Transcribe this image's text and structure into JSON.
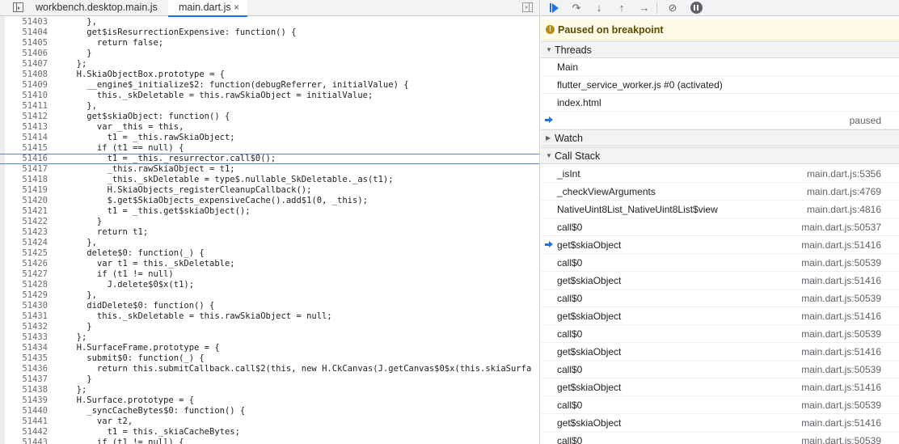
{
  "tabs": [
    {
      "label": "workbench.desktop.main.js"
    },
    {
      "label": "main.dart.js",
      "close": "×"
    }
  ],
  "code": {
    "current_line": 51416,
    "lines": [
      {
        "n": "51403",
        "t": "    },"
      },
      {
        "n": "51404",
        "t": "    get$isResurrectionExpensive: function() {"
      },
      {
        "n": "51405",
        "t": "      return false;"
      },
      {
        "n": "51406",
        "t": "    }"
      },
      {
        "n": "51407",
        "t": "  };"
      },
      {
        "n": "51408",
        "t": "  H.SkiaObjectBox.prototype = {"
      },
      {
        "n": "51409",
        "t": "    __engine$_initialize$2: function(debugReferrer, initialValue) {"
      },
      {
        "n": "51410",
        "t": "      this._skDeletable = this.rawSkiaObject = initialValue;"
      },
      {
        "n": "51411",
        "t": "    },"
      },
      {
        "n": "51412",
        "t": "    get$skiaObject: function() {"
      },
      {
        "n": "51413",
        "t": "      var _this = this,"
      },
      {
        "n": "51414",
        "t": "        t1 = _this.rawSkiaObject;"
      },
      {
        "n": "51415",
        "t": "      if (t1 == null) {"
      },
      {
        "n": "51416",
        "t": "        t1 = _this._resurrector.call$0();"
      },
      {
        "n": "51417",
        "t": "        _this.rawSkiaObject = t1;"
      },
      {
        "n": "51418",
        "t": "        _this._skDeletable = type$.nullable_SkDeletable._as(t1);"
      },
      {
        "n": "51419",
        "t": "        H.SkiaObjects_registerCleanupCallback();"
      },
      {
        "n": "51420",
        "t": "        $.get$SkiaObjects_expensiveCache().add$1(0, _this);"
      },
      {
        "n": "51421",
        "t": "        t1 = _this.get$skiaObject();"
      },
      {
        "n": "51422",
        "t": "      }"
      },
      {
        "n": "51423",
        "t": "      return t1;"
      },
      {
        "n": "51424",
        "t": "    },"
      },
      {
        "n": "51425",
        "t": "    delete$0: function(_) {"
      },
      {
        "n": "51426",
        "t": "      var t1 = this._skDeletable;"
      },
      {
        "n": "51427",
        "t": "      if (t1 != null)"
      },
      {
        "n": "51428",
        "t": "        J.delete$0$x(t1);"
      },
      {
        "n": "51429",
        "t": "    },"
      },
      {
        "n": "51430",
        "t": "    didDelete$0: function() {"
      },
      {
        "n": "51431",
        "t": "      this._skDeletable = this.rawSkiaObject = null;"
      },
      {
        "n": "51432",
        "t": "    }"
      },
      {
        "n": "51433",
        "t": "  };"
      },
      {
        "n": "51434",
        "t": "  H.SurfaceFrame.prototype = {"
      },
      {
        "n": "51435",
        "t": "    submit$0: function(_) {"
      },
      {
        "n": "51436",
        "t": "      return this.submitCallback.call$2(this, new H.CkCanvas(J.getCanvas$0$x(this.skiaSurfa"
      },
      {
        "n": "51437",
        "t": "    }"
      },
      {
        "n": "51438",
        "t": "  };"
      },
      {
        "n": "51439",
        "t": "  H.Surface.prototype = {"
      },
      {
        "n": "51440",
        "t": "    _syncCacheBytes$0: function() {"
      },
      {
        "n": "51441",
        "t": "      var t2,"
      },
      {
        "n": "51442",
        "t": "        t1 = this._skiaCacheBytes;"
      },
      {
        "n": "51443",
        "t": "      if (t1 != null) {"
      }
    ]
  },
  "debugger": {
    "paused_message": "Paused on breakpoint",
    "threads": {
      "label": "Threads",
      "items": [
        {
          "name": "Main",
          "status": ""
        },
        {
          "name": "flutter_service_worker.js #0 (activated)",
          "status": ""
        },
        {
          "name": "index.html",
          "status": ""
        },
        {
          "name": "",
          "status": "paused",
          "current": true
        }
      ]
    },
    "watch": {
      "label": "Watch"
    },
    "call_stack": {
      "label": "Call Stack",
      "frames": [
        {
          "fn": "_isInt",
          "loc": "main.dart.js:5356"
        },
        {
          "fn": "_checkViewArguments",
          "loc": "main.dart.js:4769"
        },
        {
          "fn": "NativeUint8List_NativeUint8List$view",
          "loc": "main.dart.js:4816"
        },
        {
          "fn": "call$0",
          "loc": "main.dart.js:50537"
        },
        {
          "fn": "get$skiaObject",
          "loc": "main.dart.js:51416",
          "current": true
        },
        {
          "fn": "call$0",
          "loc": "main.dart.js:50539"
        },
        {
          "fn": "get$skiaObject",
          "loc": "main.dart.js:51416"
        },
        {
          "fn": "call$0",
          "loc": "main.dart.js:50539"
        },
        {
          "fn": "get$skiaObject",
          "loc": "main.dart.js:51416"
        },
        {
          "fn": "call$0",
          "loc": "main.dart.js:50539"
        },
        {
          "fn": "get$skiaObject",
          "loc": "main.dart.js:51416"
        },
        {
          "fn": "call$0",
          "loc": "main.dart.js:50539"
        },
        {
          "fn": "get$skiaObject",
          "loc": "main.dart.js:51416"
        },
        {
          "fn": "call$0",
          "loc": "main.dart.js:50539"
        },
        {
          "fn": "get$skiaObject",
          "loc": "main.dart.js:51416"
        },
        {
          "fn": "call$0",
          "loc": "main.dart.js:50539"
        }
      ]
    }
  }
}
